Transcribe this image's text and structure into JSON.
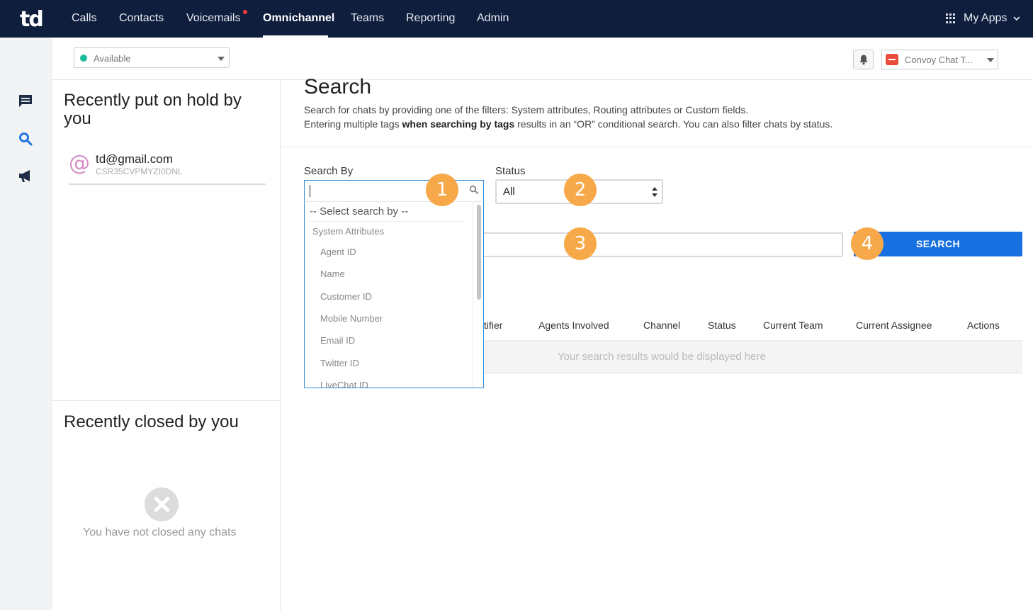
{
  "nav": {
    "logo": "td",
    "items": [
      {
        "label": "Calls"
      },
      {
        "label": "Contacts"
      },
      {
        "label": "Voicemails"
      },
      {
        "label": "Omnichannel"
      },
      {
        "label": "Teams"
      },
      {
        "label": "Reporting"
      },
      {
        "label": "Admin"
      }
    ],
    "active": "Omnichannel",
    "apps_label": "My Apps",
    "apps_icon": "grid-icon",
    "chevron_icon": "chevron-down-icon"
  },
  "rail": {
    "icons": [
      "chat-icon",
      "search-icon",
      "megaphone-icon"
    ],
    "active_color": "#1870e0"
  },
  "subheader": {
    "availability": "Available",
    "availability_color": "#1abc9c",
    "integration": "Convoy Chat T..."
  },
  "left_panel": {
    "hold_title": "Recently put on hold by you",
    "hold_items": [
      {
        "email": "td@gmail.com",
        "id": "CSR35CVPMYZI0DNL"
      }
    ],
    "closed_title": "Recently closed by you",
    "closed_empty": "You have not closed any chats"
  },
  "main": {
    "title": "Search",
    "desc_line1": "Search for chats by providing one of the filters: System attributes, Routing attributes or Custom fields.",
    "desc_line2_pre": "Entering multiple tags ",
    "desc_line2_bold": "when searching by tags",
    "desc_line2_post": " results in an “OR” conditional search. You can also filter chats by status.",
    "search_by_label": "Search By",
    "status_label": "Status",
    "status_value": "All",
    "dropdown": {
      "placeholder": "-- Select search by --",
      "group": "System Attributes",
      "options": [
        "Agent ID",
        "Name",
        "Customer ID",
        "Mobile Number",
        "Email ID",
        "Twitter ID",
        "LiveChat ID"
      ]
    },
    "search_button": "SEARCH",
    "columns": [
      "tifier",
      "Agents Involved",
      "Channel",
      "Status",
      "Current Team",
      "Current Assignee",
      "Actions"
    ],
    "results_placeholder": "Your search results would be displayed here",
    "badges": [
      "1",
      "2",
      "3",
      "4"
    ],
    "accent": "#1870e0",
    "badge_color": "#f7a94a"
  }
}
